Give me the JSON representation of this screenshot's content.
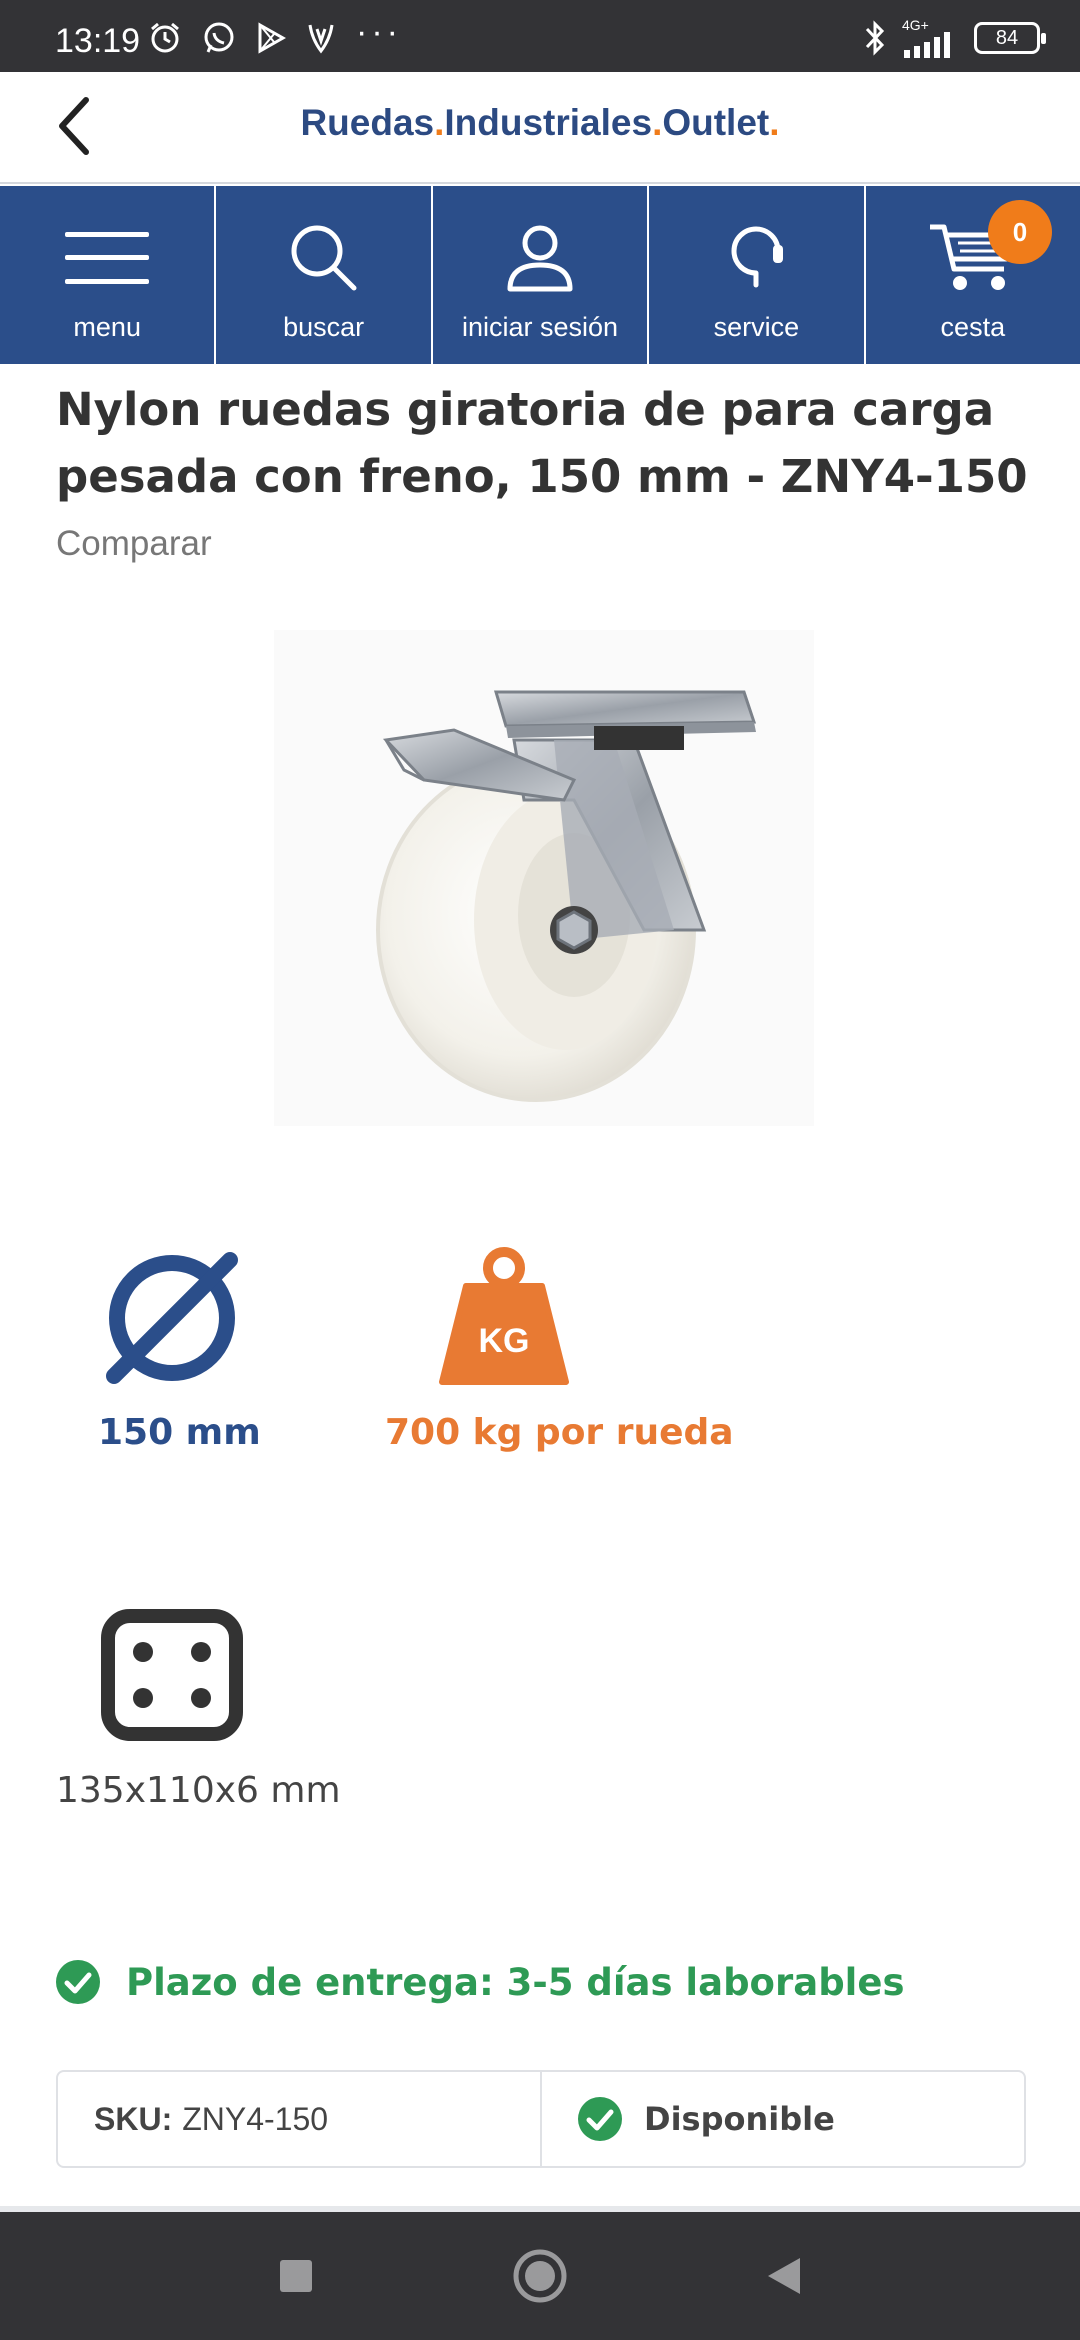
{
  "status_bar": {
    "time": "13:19",
    "network": "4G+",
    "battery": "84"
  },
  "header": {
    "brand_parts": [
      "Ruedas",
      ".",
      "Industriales",
      ".",
      "Outlet",
      "."
    ]
  },
  "nav": {
    "items": [
      {
        "label": "menu",
        "icon": "hamburger-icon"
      },
      {
        "label": "buscar",
        "icon": "search-icon"
      },
      {
        "label": "iniciar sesión",
        "icon": "user-icon"
      },
      {
        "label": "service",
        "icon": "headset-icon"
      },
      {
        "label": "cesta",
        "icon": "cart-icon"
      }
    ],
    "cart_count": "0"
  },
  "product": {
    "title": "Nylon ruedas giratoria de para carga pesada con freno, 150 mm - ZNY4-150",
    "compare": "Comparar"
  },
  "specs": {
    "diameter": "150 mm",
    "load": "700 kg por rueda",
    "load_icon_text": "KG",
    "plate": "135x110x6 mm"
  },
  "delivery": {
    "text": "Plazo de entrega: 3-5 días laborables"
  },
  "sku": {
    "key": "SKU:",
    "value": "ZNY4-150",
    "availability": "Disponible"
  },
  "colors": {
    "brand_blue": "#2b4e8a",
    "accent_orange": "#f07c1a",
    "success_green": "#2e9a55"
  }
}
